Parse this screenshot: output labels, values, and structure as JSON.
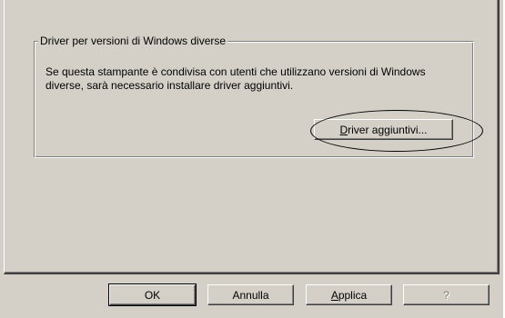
{
  "group": {
    "title": "Driver per versioni di Windows diverse",
    "description": "Se questa stampante è condivisa con utenti che utilizzano versioni di Windows diverse, sarà necessario installare driver aggiuntivi."
  },
  "buttons": {
    "additional_drivers": {
      "accel": "D",
      "rest": "river aggiuntivi..."
    },
    "ok": "OK",
    "cancel": "Annulla",
    "apply": {
      "accel": "A",
      "rest": "pplica"
    },
    "help": "?"
  },
  "colors": {
    "dialog_bg": "#d4d0c8",
    "highlight": "#000000"
  }
}
